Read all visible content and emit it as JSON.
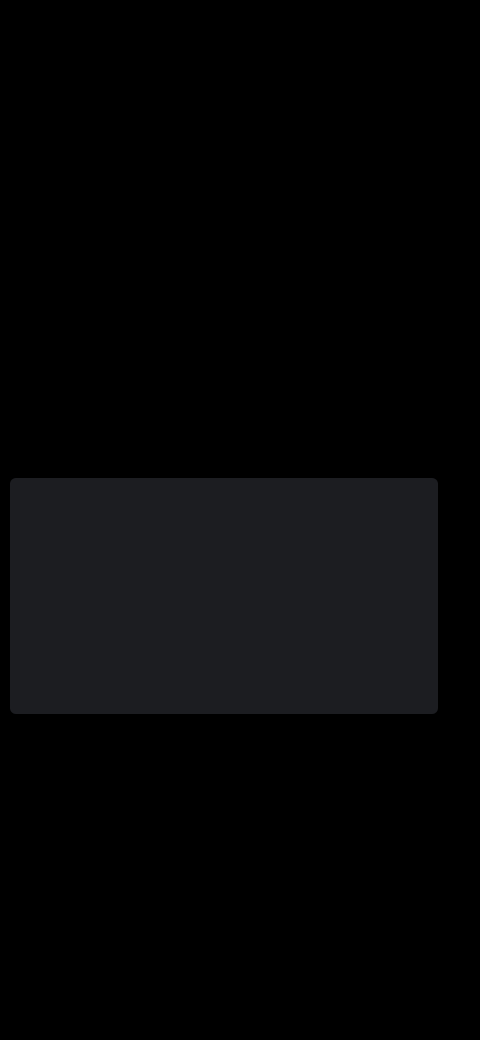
{
  "status_bar": {
    "time": "",
    "icons": ""
  },
  "step": {
    "label": ""
  },
  "question": {
    "text": ""
  },
  "picker": {
    "selected_label": "",
    "month": "",
    "separator": "",
    "year": ""
  },
  "navigation": {
    "back_label": "",
    "next_label": ""
  }
}
